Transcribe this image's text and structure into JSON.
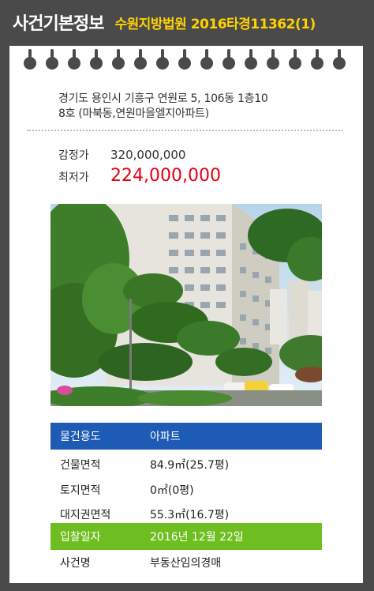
{
  "header": {
    "title": "사건기본정보",
    "case_label": "수원지방법원 2016타경11362(1)"
  },
  "address": {
    "line1": "경기도 용인시 기흥구 연원로 5, 106동 1층10",
    "line2": "8호 (마북동,연원마을엘지아파트)"
  },
  "prices": {
    "appraisal_label": "감정가",
    "appraisal_value": "320,000,000",
    "minimum_label": "최저가",
    "minimum_value": "224,000,000"
  },
  "info": [
    {
      "key": "물건용도",
      "value": "아파트"
    },
    {
      "key": "건물면적",
      "value": "84.9㎡(25.7평)"
    },
    {
      "key": "토지면적",
      "value": "0㎡(0평)"
    },
    {
      "key": "대지권면적",
      "value": "55.3㎡(16.7평)"
    },
    {
      "key": "입찰일자",
      "value": "2016년 12월 22일"
    },
    {
      "key": "사건명",
      "value": "부동산임의경매"
    }
  ],
  "colors": {
    "accent_yellow": "#ffd200",
    "price_red": "#e60012",
    "row_blue": "#1e5bb4",
    "row_green": "#6fbe21"
  }
}
